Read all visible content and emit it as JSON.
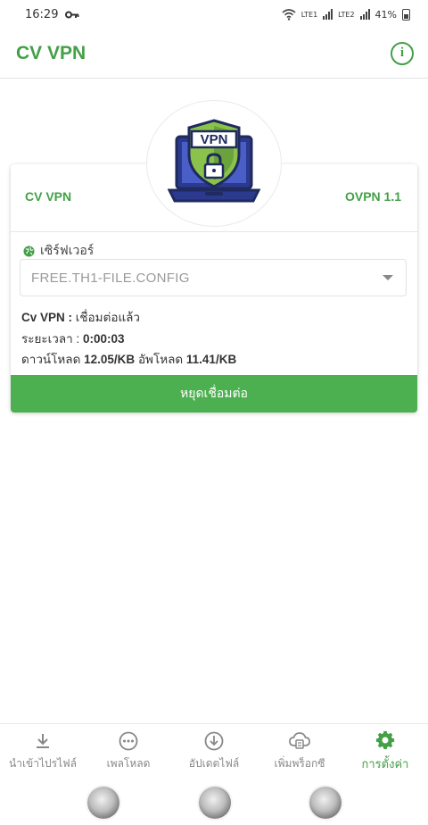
{
  "status_bar": {
    "time": "16:29",
    "battery": "41%",
    "sim1": "LTE1",
    "sim2": "LTE2"
  },
  "app_bar": {
    "title": "CV VPN"
  },
  "card": {
    "left_label": "CV VPN",
    "right_label": "OVPN 1.1",
    "logo_text": "VPN",
    "server_label": "เซิร์ฟเวอร์",
    "server_value": "FREE.TH1-FILE.CONFIG",
    "status_prefix": "Cv VPN :",
    "status_value": "เชื่อมต่อแล้ว",
    "duration_prefix": "ระยะเวลา :",
    "duration_value": "0:00:03",
    "download_label": "ดาวน์โหลด",
    "download_value": "12.05/KB",
    "upload_label": "อัพโหลด",
    "upload_value": "11.41/KB",
    "disconnect_label": "หยุดเชื่อมต่อ"
  },
  "bottom_nav": {
    "items": [
      {
        "label": "นำเข้าไปรไฟล์",
        "icon": "import-icon"
      },
      {
        "label": "เพลโหลด",
        "icon": "more-icon"
      },
      {
        "label": "อัปเดตไฟล์",
        "icon": "update-icon"
      },
      {
        "label": "เพิ่มพร็อกซี",
        "icon": "proxy-icon"
      },
      {
        "label": "การตั้งค่า",
        "icon": "settings-icon"
      }
    ]
  },
  "colors": {
    "accent": "#43a047",
    "button": "#4caf50"
  }
}
